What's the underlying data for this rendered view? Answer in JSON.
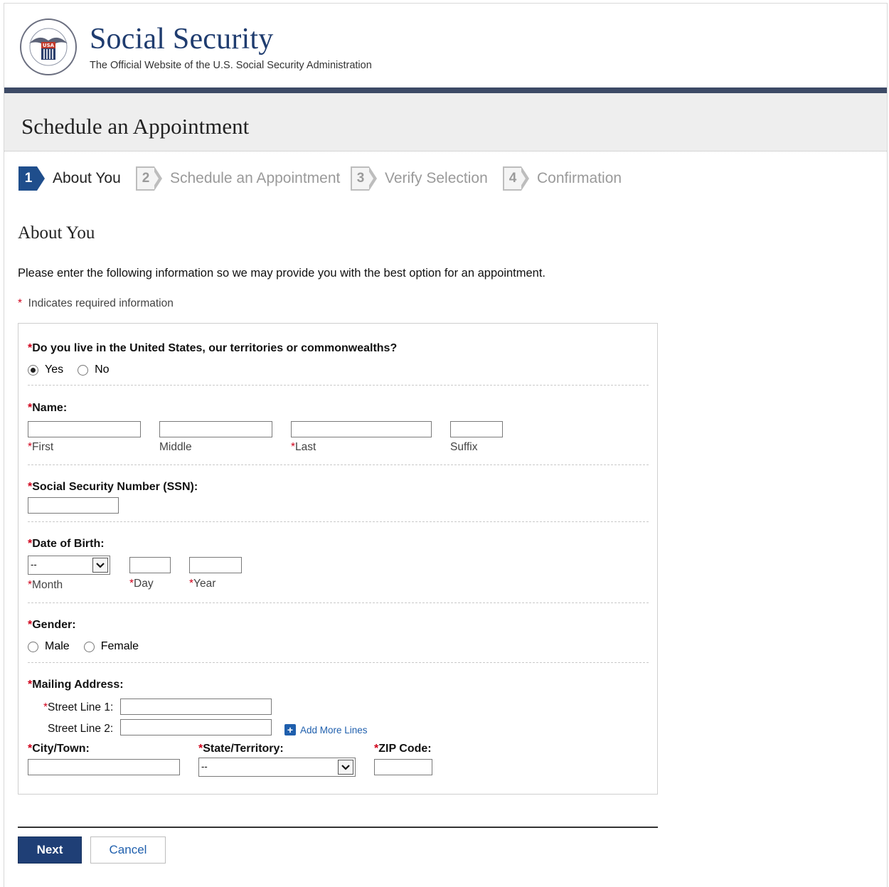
{
  "header": {
    "site_title": "Social Security",
    "tagline": "The Official Website of the U.S. Social Security Administration",
    "seal_text": "SOCIAL SECURITY ADMINISTRATION USA"
  },
  "page": {
    "title": "Schedule an Appointment"
  },
  "steps": [
    {
      "num": "1",
      "label": "About You",
      "active": true
    },
    {
      "num": "2",
      "label": "Schedule an Appointment",
      "active": false
    },
    {
      "num": "3",
      "label": "Verify Selection",
      "active": false
    },
    {
      "num": "4",
      "label": "Confirmation",
      "active": false
    }
  ],
  "section": {
    "title": "About You",
    "intro": "Please enter the following information so we may provide you with the best option for an appointment.",
    "required_marker": "*",
    "required_note": "Indicates required information"
  },
  "form": {
    "residence": {
      "label": "Do you live in the United States, our territories or commonwealths?",
      "yes": "Yes",
      "no": "No",
      "selected": "Yes"
    },
    "name": {
      "label": "Name:",
      "first": "First",
      "middle": "Middle",
      "last": "Last",
      "suffix": "Suffix"
    },
    "ssn": {
      "label": "Social Security Number (SSN):"
    },
    "dob": {
      "label": "Date of Birth:",
      "month_value": "--",
      "month": "Month",
      "day": "Day",
      "year": "Year"
    },
    "gender": {
      "label": "Gender:",
      "male": "Male",
      "female": "Female"
    },
    "address": {
      "label": "Mailing Address:",
      "street1": "Street Line 1:",
      "street2": "Street Line 2:",
      "add_more": "Add More Lines",
      "city": "City/Town:",
      "state": "State/Territory:",
      "state_value": "--",
      "zip": "ZIP Code:"
    }
  },
  "buttons": {
    "next": "Next",
    "cancel": "Cancel"
  },
  "colors": {
    "brand_navy": "#1f3c6f",
    "active_step": "#1f4e8c",
    "required": "#d0021b",
    "link": "#1f5fad"
  }
}
